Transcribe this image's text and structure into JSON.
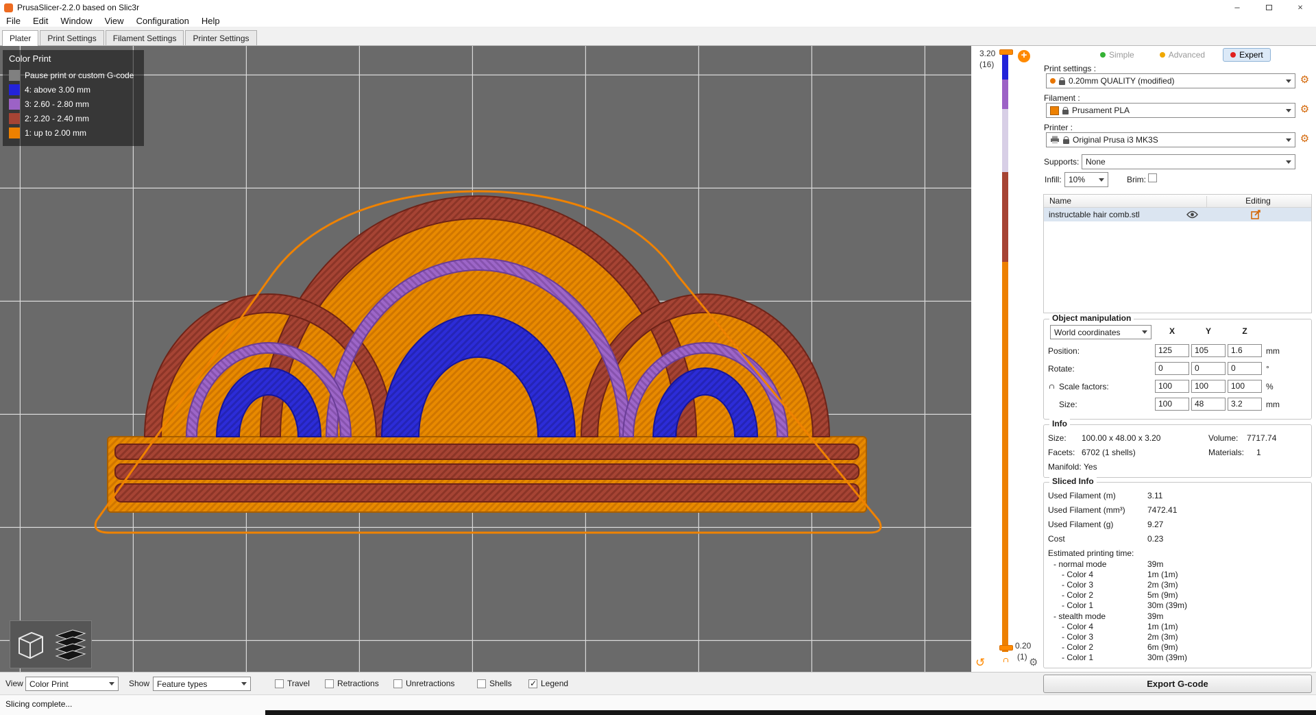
{
  "window": {
    "title": "PrusaSlicer-2.2.0 based on Slic3r"
  },
  "menu": {
    "items": [
      "File",
      "Edit",
      "Window",
      "View",
      "Configuration",
      "Help"
    ]
  },
  "tabs": {
    "items": [
      "Plater",
      "Print Settings",
      "Filament Settings",
      "Printer Settings"
    ]
  },
  "viewport": {
    "legend": {
      "title": "Color Print",
      "items": [
        {
          "label": "Pause print or custom G-code",
          "color": "#808080"
        },
        {
          "label": "4: above 3.00 mm",
          "color": "#2323d9"
        },
        {
          "label": "3: 2.60 - 2.80 mm",
          "color": "#9c62c6"
        },
        {
          "label": "2: 2.20 - 2.40 mm",
          "color": "#a64434"
        },
        {
          "label": "1: up to 2.00 mm",
          "color": "#ed8000"
        }
      ]
    }
  },
  "layer_slider": {
    "top_value": "3.20",
    "top_layer": "(16)",
    "bottom_value": "0.20",
    "bottom_layer": "(1)"
  },
  "panel": {
    "modes": {
      "simple": "Simple",
      "advanced": "Advanced",
      "expert": "Expert"
    },
    "print_settings": {
      "label": "Print settings :",
      "value": "0.20mm QUALITY (modified)"
    },
    "filament": {
      "label": "Filament :",
      "value": "Prusament PLA"
    },
    "printer": {
      "label": "Printer :",
      "value": "Original Prusa i3 MK3S"
    },
    "supports": {
      "label": "Supports:",
      "value": "None"
    },
    "infill": {
      "label": "Infill:",
      "value": "10%"
    },
    "brim": {
      "label": "Brim:"
    },
    "object_list": {
      "name_header": "Name",
      "editing_header": "Editing",
      "rows": [
        {
          "name": "instructable hair comb.stl"
        }
      ]
    },
    "object_manipulation": {
      "title": "Object manipulation",
      "coordinates": "World coordinates",
      "axis_x": "X",
      "axis_y": "Y",
      "axis_z": "Z",
      "position": {
        "label": "Position:",
        "x": "125",
        "y": "105",
        "z": "1.6",
        "unit": "mm"
      },
      "rotate": {
        "label": "Rotate:",
        "x": "0",
        "y": "0",
        "z": "0",
        "unit": "°"
      },
      "scale": {
        "label": "Scale factors:",
        "x": "100",
        "y": "100",
        "z": "100",
        "unit": "%"
      },
      "size": {
        "label": "Size:",
        "x": "100",
        "y": "48",
        "z": "3.2",
        "unit": "mm"
      }
    },
    "info": {
      "title": "Info",
      "size_label": "Size:",
      "size_value": "100.00 x 48.00 x 3.20",
      "volume_label": "Volume:",
      "volume_value": "7717.74",
      "facets_label": "Facets:",
      "facets_value": "6702 (1 shells)",
      "materials_label": "Materials:",
      "materials_value": "1",
      "manifold_label": "Manifold:",
      "manifold_value": "Yes"
    },
    "sliced_info": {
      "title": "Sliced Info",
      "rows": [
        {
          "label": "Used Filament (m)",
          "value": "3.11"
        },
        {
          "label": "Used Filament (mm³)",
          "value": "7472.41"
        },
        {
          "label": "Used Filament (g)",
          "value": "9.27"
        },
        {
          "label": "Cost",
          "value": "0.23"
        }
      ],
      "estimated_label": "Estimated printing time:",
      "time_rows": [
        {
          "label": "- normal mode",
          "value": "39m"
        },
        {
          "label": "- Color 4",
          "value": "1m (1m)"
        },
        {
          "label": "- Color 3",
          "value": "2m (3m)"
        },
        {
          "label": "- Color 2",
          "value": "5m (9m)"
        },
        {
          "label": "- Color 1",
          "value": "30m (39m)"
        },
        {
          "label": "- stealth mode",
          "value": "39m"
        },
        {
          "label": "- Color 4",
          "value": "1m (1m)"
        },
        {
          "label": "- Color 3",
          "value": "2m (3m)"
        },
        {
          "label": "- Color 2",
          "value": "6m (9m)"
        },
        {
          "label": "- Color 1",
          "value": "30m (39m)"
        }
      ]
    },
    "export_button": "Export G-code"
  },
  "bottom_bar": {
    "view_label": "View",
    "view_value": "Color Print",
    "show_label": "Show",
    "show_value": "Feature types",
    "checkboxes": [
      {
        "label": "Travel",
        "checked": false
      },
      {
        "label": "Retractions",
        "checked": false
      },
      {
        "label": "Unretractions",
        "checked": false
      },
      {
        "label": "Shells",
        "checked": false
      },
      {
        "label": "Legend",
        "checked": true
      }
    ]
  },
  "status_bar": {
    "message": "Slicing complete..."
  },
  "colors": {
    "accent_orange": "#ed8000",
    "model_orange": "#e88a00",
    "model_maroon": "#a64434",
    "model_purple": "#9c62c6",
    "model_blue": "#2c2cd8",
    "mode_simple_dot": "#35b235",
    "mode_advanced_dot": "#f0a800",
    "mode_expert_dot": "#e02020",
    "slider_pale_segment": "#d8cfe6"
  }
}
